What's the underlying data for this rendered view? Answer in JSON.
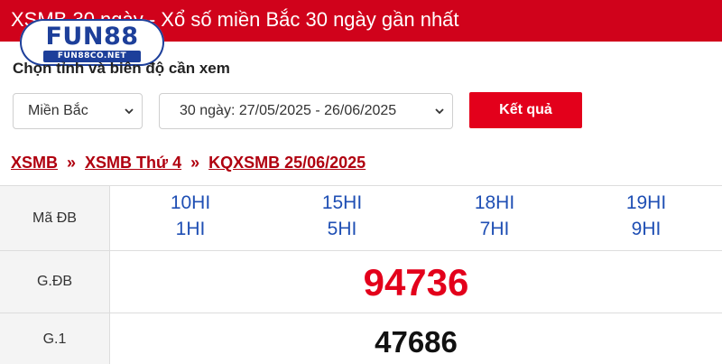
{
  "header": {
    "title": "XSMB 30 ngày - Xổ số miền Bắc 30 ngày gần nhất"
  },
  "logo": {
    "brand_prefix": "FUN",
    "brand_number": "88",
    "subtext": "FUN88CO.NET"
  },
  "form": {
    "label": "Chọn tỉnh và biên độ cần xem",
    "region_select": "Miền Bắc",
    "range_select": "30 ngày: 27/05/2025 - 26/06/2025",
    "submit_label": "Kết quả"
  },
  "breadcrumb": {
    "items": [
      "XSMB",
      "XSMB Thứ 4",
      "KQXSMB 25/06/2025"
    ],
    "separator": "»"
  },
  "results": {
    "code_label": "Mã ĐB",
    "codes": [
      [
        "10HI",
        "1HI"
      ],
      [
        "15HI",
        "5HI"
      ],
      [
        "18HI",
        "7HI"
      ],
      [
        "19HI",
        "9HI"
      ]
    ],
    "special_label": "G.ĐB",
    "special_value": "94736",
    "first_label": "G.1",
    "first_value": "47686"
  },
  "colors": {
    "header_red": "#d0021b",
    "button_red": "#e3001b",
    "link_red": "#b0000f",
    "code_blue": "#1f4fb4",
    "logo_blue": "#1d3f9a"
  }
}
